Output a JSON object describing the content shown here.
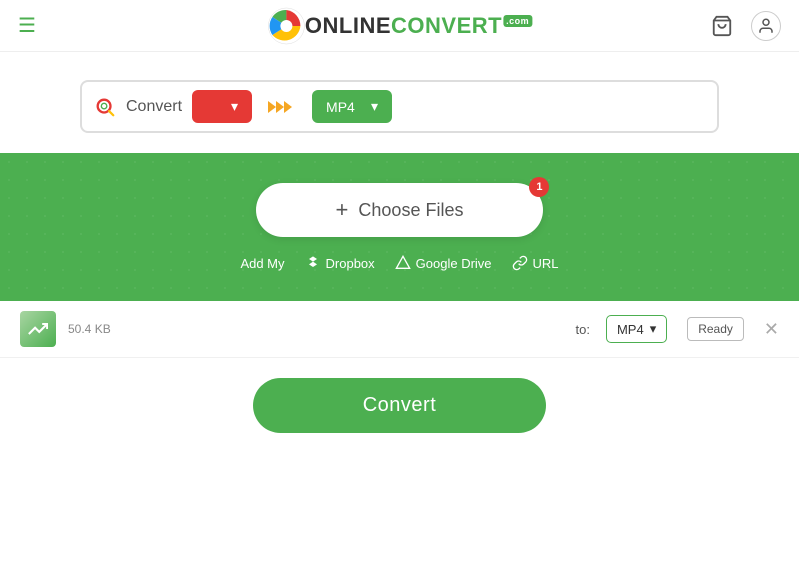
{
  "header": {
    "hamburger": "☰",
    "logo": {
      "online": "ONLINE",
      "convert": "CONVERT",
      "com": ".com"
    },
    "cart_icon": "🛒",
    "user_icon": "👤"
  },
  "search": {
    "icon": "🔍",
    "label": "Convert",
    "from_placeholder": "",
    "arrows": "❯❯❯",
    "to_format": "MP4",
    "chevron": "▾"
  },
  "upload": {
    "choose_files_label": "Choose Files",
    "plus": "+",
    "badge_count": "1",
    "add_my_label": "Add My",
    "dropbox_label": "Dropbox",
    "google_drive_label": "Google Drive",
    "url_label": "URL"
  },
  "file_row": {
    "size": "50.4 KB",
    "to_label": "to:",
    "format": "MP4",
    "chevron": "▾",
    "status": "Ready",
    "close": "✕"
  },
  "convert": {
    "button_label": "Convert"
  }
}
